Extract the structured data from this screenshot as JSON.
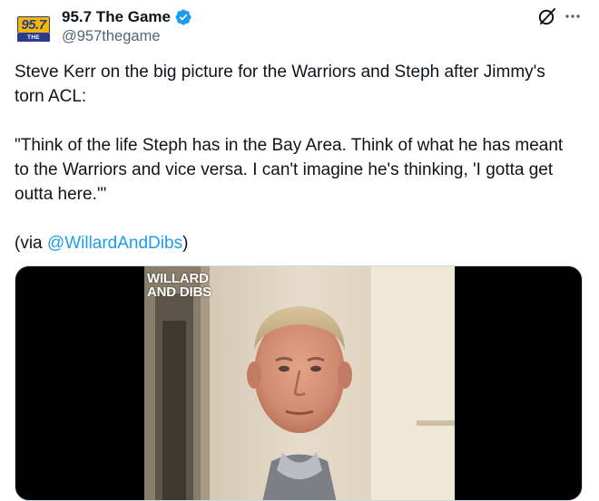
{
  "account": {
    "display_name": "95.7 The Game",
    "handle": "@957thegame",
    "avatar_logo": {
      "number": "95.7",
      "tagline": "THE GAME"
    },
    "verified": true
  },
  "icons": {
    "verified": "verified-badge-icon",
    "grok": "grok-icon",
    "more": "more-options-icon"
  },
  "colors": {
    "text": "#0f1419",
    "secondary": "#536471",
    "link": "#1d9bf0",
    "brand_yellow": "#f5b800",
    "brand_blue": "#2a3c8f"
  },
  "tweet": {
    "line1": "Steve Kerr on the big picture for the Warriors and Steph after Jimmy's torn ACL:",
    "quote": "\"Think of the life Steph has in the Bay Area. Think of what he has meant to the Warriors and vice versa. I can't imagine he's thinking, 'I gotta get outta here.'\"",
    "via_prefix": "(via ",
    "via_mention": "@WillardAndDibs",
    "via_suffix": ")"
  },
  "media": {
    "watermark": "WILLARD\nAND DIBS"
  }
}
